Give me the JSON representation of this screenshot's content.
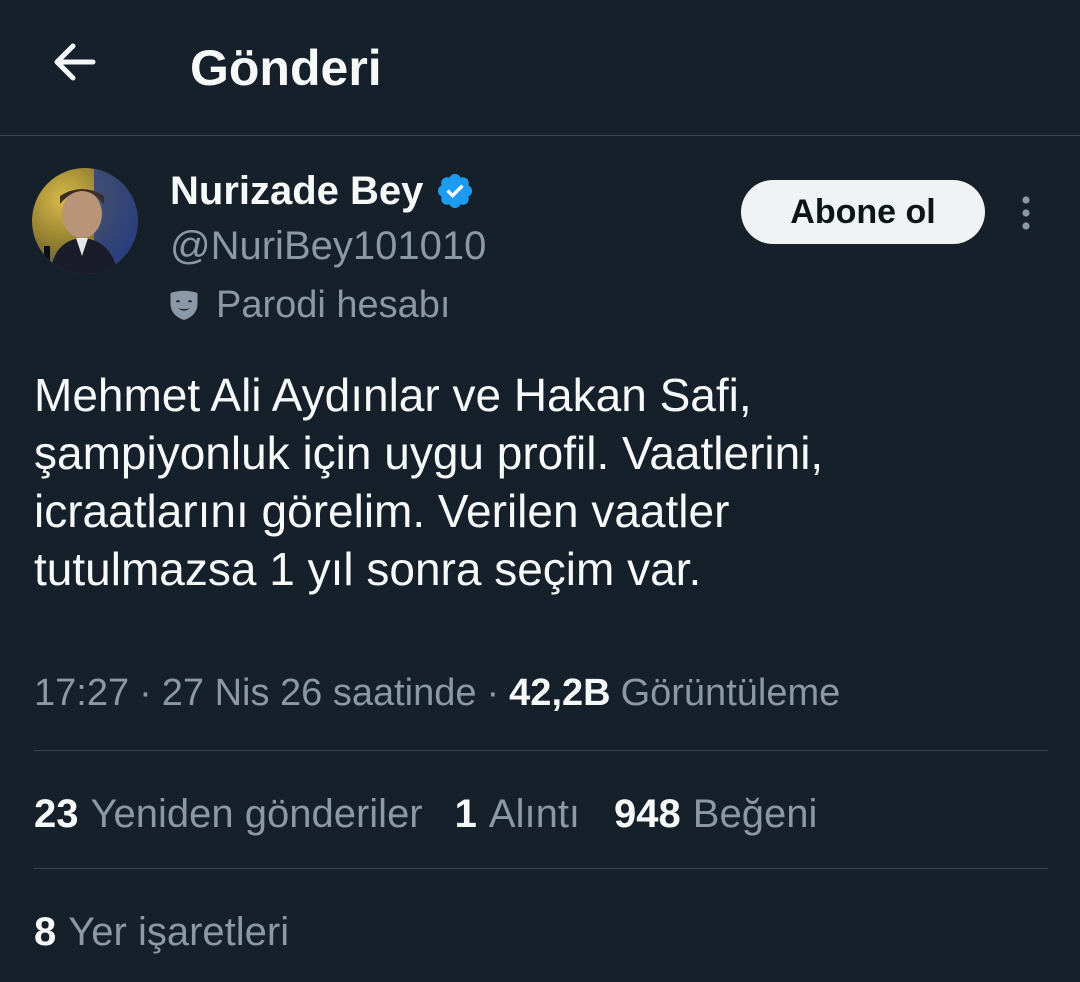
{
  "header": {
    "title": "Gönderi",
    "back_icon": "arrow-left-icon"
  },
  "author": {
    "display_name": "Nurizade Bey",
    "handle": "@NuriBey101010",
    "verified_icon": "verified-badge-icon",
    "parody_icon": "theater-mask-icon",
    "parody_label": "Parodi hesabı"
  },
  "actions": {
    "subscribe_label": "Abone ol",
    "more_icon": "more-vertical-icon"
  },
  "tweet": {
    "text": "Mehmet Ali Aydınlar ve Hakan Safi,\nşampiyonluk için uygu profil. Vaatlerini,\nicraatlarını görelim. Verilen vaatler\ntutulmazsa 1 yıl sonra seçim var.",
    "time": "17:27",
    "date": "27 Nis 26 saatinde",
    "views_count": "42,2B",
    "views_label": "Görüntüleme",
    "separator": "·"
  },
  "stats": {
    "retweets_count": "23",
    "retweets_label": "Yeniden gönderiler",
    "quotes_count": "1",
    "quotes_label": "Alıntı",
    "likes_count": "948",
    "likes_label": "Beğeni",
    "bookmarks_count": "8",
    "bookmarks_label": "Yer işaretleri"
  },
  "colors": {
    "background": "#15202b",
    "text_primary": "#f7f9f9",
    "text_secondary": "#8b98a5",
    "divider": "#38444d",
    "verified": "#1d9bf0",
    "button_bg": "#eff3f4"
  }
}
